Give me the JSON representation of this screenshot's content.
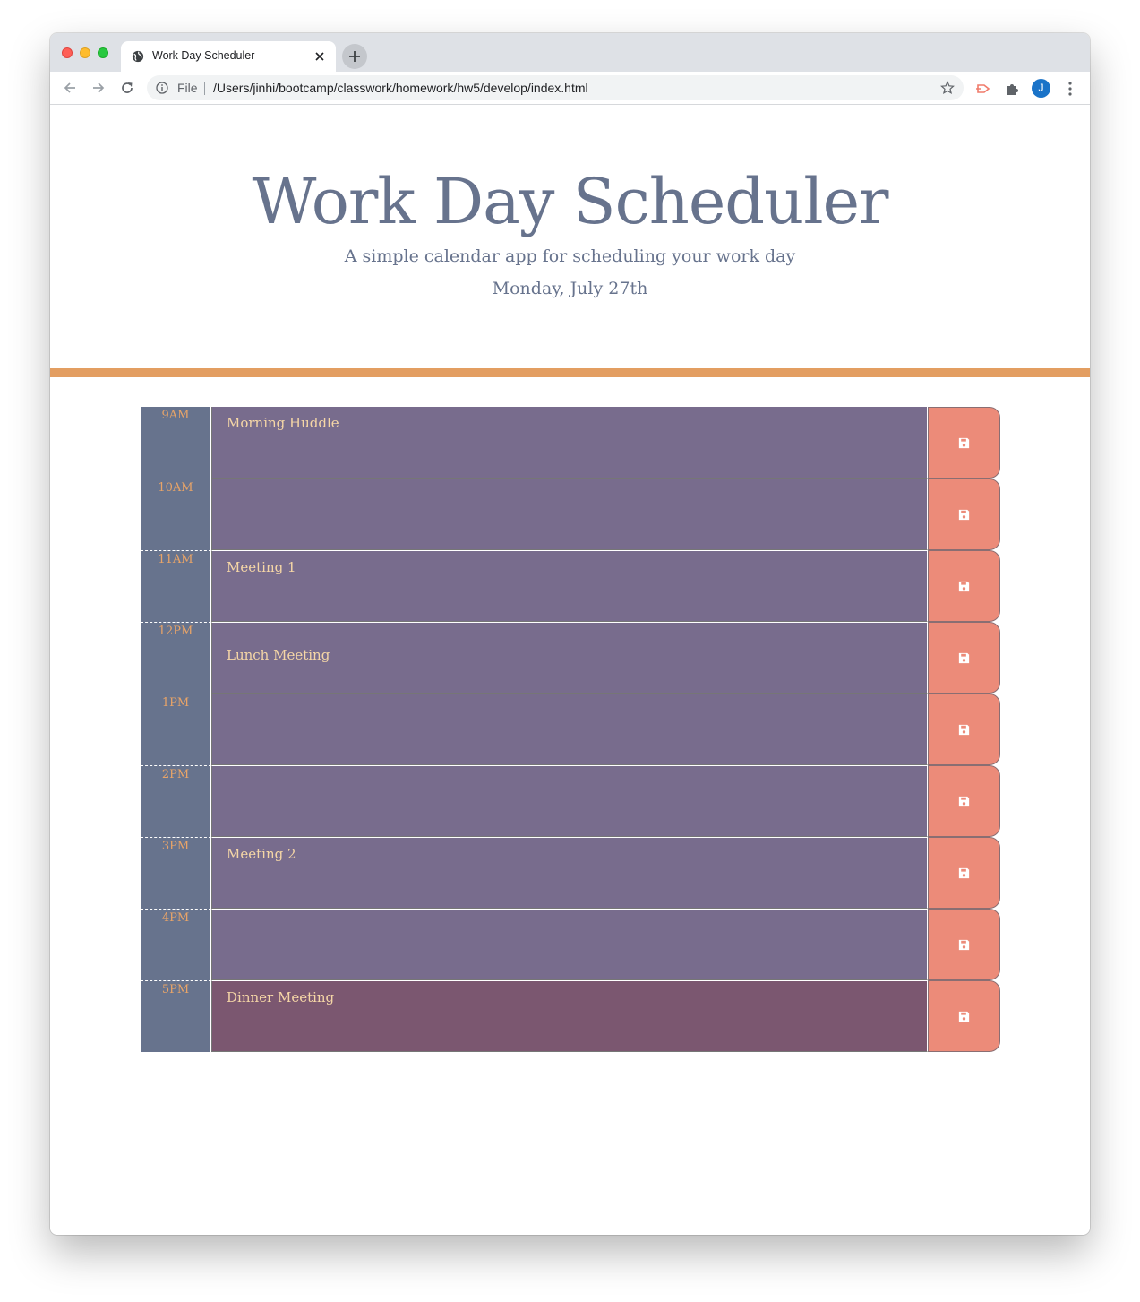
{
  "browser": {
    "tab_title": "Work Day Scheduler",
    "url_scheme_label": "File",
    "url": "/Users/jinhi/bootcamp/classwork/homework/hw5/develop/index.html",
    "profile_initial": "J"
  },
  "header": {
    "title": "Work Day Scheduler",
    "subtitle": "A simple calendar app for scheduling your work day",
    "current_day": "Monday, July 27th"
  },
  "colors": {
    "title_text": "#67738d",
    "accent_rule": "#e39e61",
    "hour_column": "#67738d",
    "hour_text": "#e8a468",
    "future_block": "#786c8d",
    "present_block": "#7b5770",
    "save_button": "#ec8b79",
    "description_text": "#f5d6a6"
  },
  "schedule": {
    "blocks": [
      {
        "hour": "9AM",
        "text": "Morning Huddle",
        "status": "future",
        "save_icon": "floppy-disk-icon"
      },
      {
        "hour": "10AM",
        "text": "",
        "status": "future",
        "save_icon": "floppy-disk-icon"
      },
      {
        "hour": "11AM",
        "text": "Meeting 1",
        "status": "future",
        "save_icon": "floppy-disk-icon"
      },
      {
        "hour": "12PM",
        "text": "\nLunch Meeting",
        "status": "future",
        "save_icon": "floppy-disk-icon"
      },
      {
        "hour": "1PM",
        "text": "",
        "status": "future",
        "save_icon": "floppy-disk-icon"
      },
      {
        "hour": "2PM",
        "text": "",
        "status": "future",
        "save_icon": "floppy-disk-icon"
      },
      {
        "hour": "3PM",
        "text": "Meeting 2",
        "status": "future",
        "save_icon": "floppy-disk-icon"
      },
      {
        "hour": "4PM",
        "text": "",
        "status": "future",
        "save_icon": "floppy-disk-icon"
      },
      {
        "hour": "5PM",
        "text": "Dinner Meeting",
        "status": "present",
        "save_icon": "floppy-disk-icon"
      }
    ]
  }
}
